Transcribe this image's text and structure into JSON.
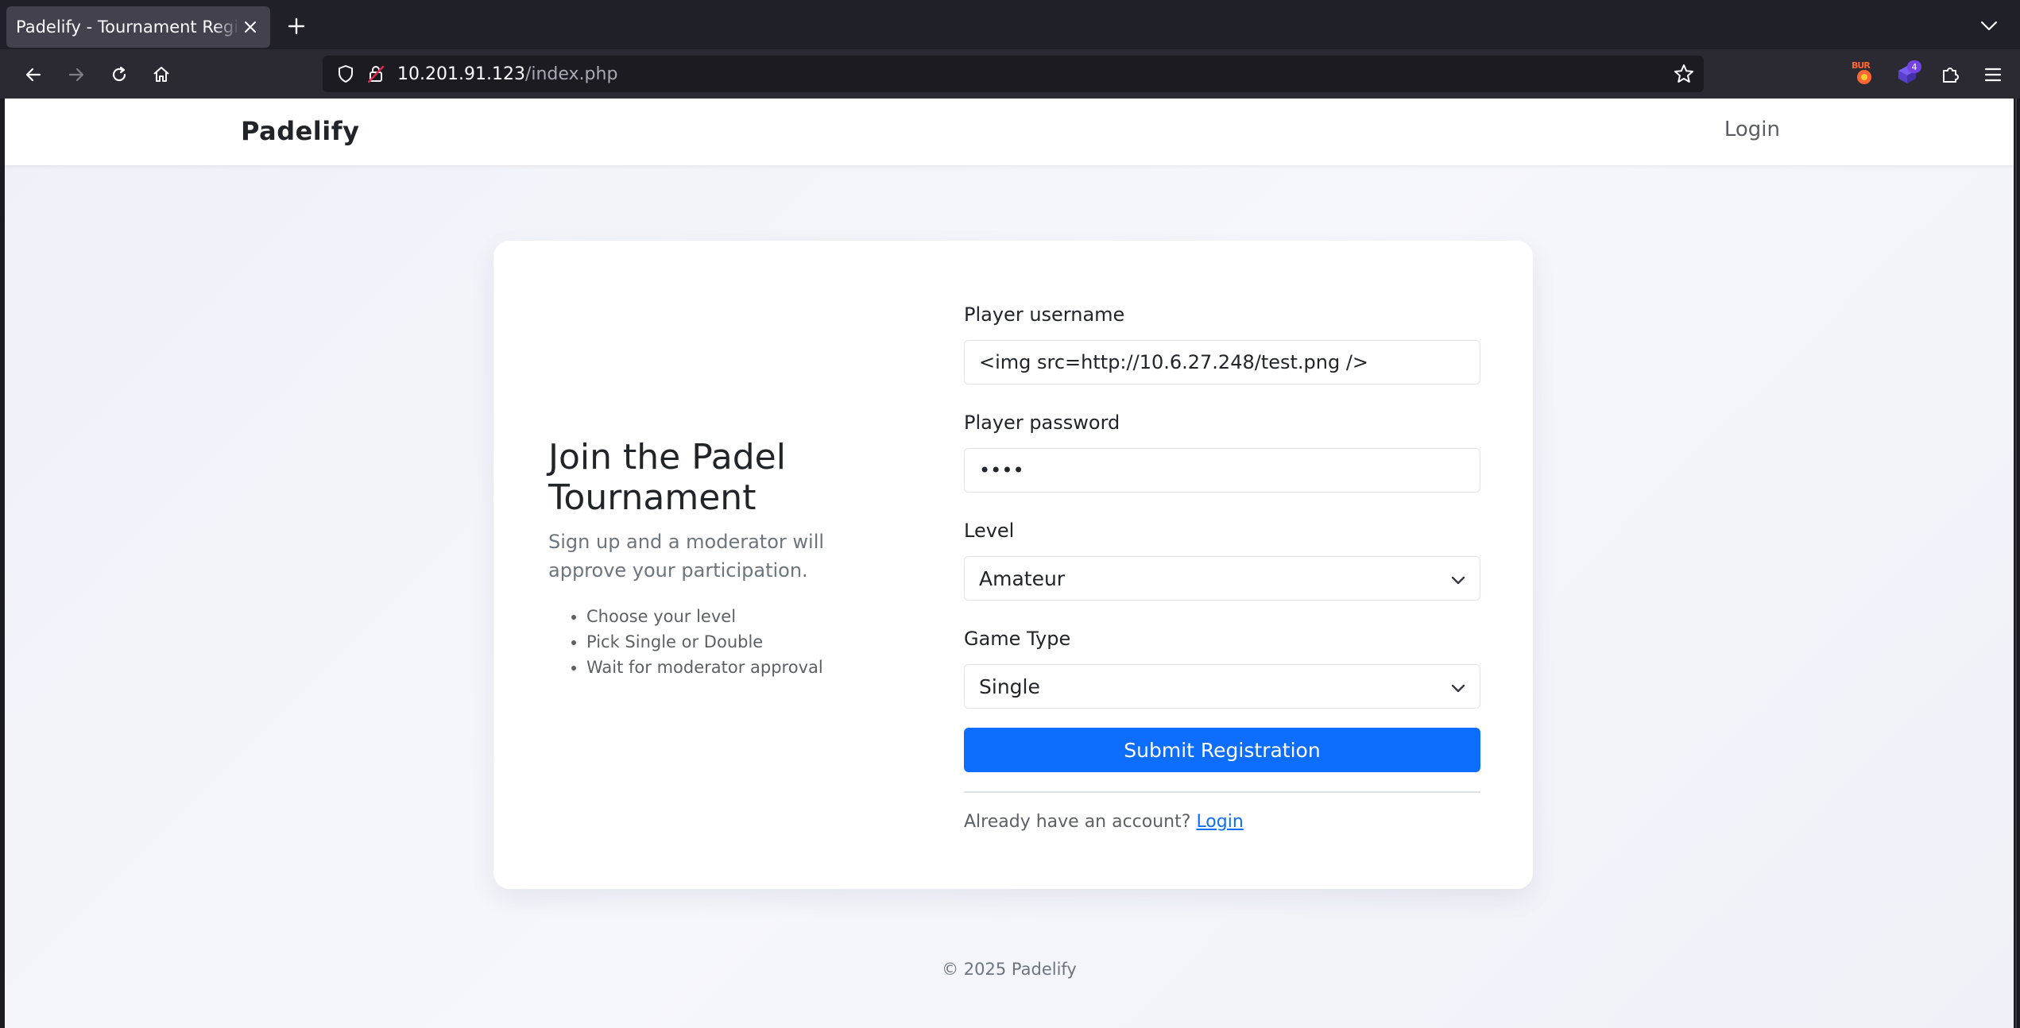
{
  "browser": {
    "tab_title": "Padelify - Tournament Registration",
    "url_host": "10.201.91.123",
    "url_path": "/index.php",
    "extensions": [
      {
        "name": "burp-extension-icon",
        "label": "BUR"
      },
      {
        "name": "extension-icon",
        "badge": "4"
      }
    ],
    "icons": {
      "tab_close": "close-icon",
      "new_tab": "plus-icon",
      "tab_list": "chevron-down-icon",
      "back": "arrow-left-icon",
      "forward": "arrow-right-icon",
      "reload": "reload-icon",
      "home": "home-icon",
      "tracking": "shield-icon",
      "insecure": "lock-warning-icon",
      "bookmark": "star-icon",
      "extensions": "puzzle-icon",
      "menu": "hamburger-icon"
    }
  },
  "site": {
    "brand": "Padelify",
    "header_login": "Login"
  },
  "intro": {
    "heading": "Join the Padel Tournament",
    "lead": "Sign up and a moderator will approve your participation.",
    "bullets": [
      "Choose your level",
      "Pick Single or Double",
      "Wait for moderator approval"
    ]
  },
  "form": {
    "username_label": "Player username",
    "username_value": "<img src=http://10.6.27.248/test.png />",
    "password_label": "Player password",
    "password_value": "••••",
    "level_label": "Level",
    "level_value": "Amateur",
    "game_type_label": "Game Type",
    "game_type_value": "Single",
    "submit_label": "Submit Registration",
    "already_text": "Already have an account?",
    "login_link": "Login"
  },
  "footer": {
    "copyright": "© 2025 Padelify"
  },
  "colors": {
    "primary": "#0d6efd",
    "browser_chrome": "#2b2a33",
    "tab_strip": "#1f2028"
  }
}
